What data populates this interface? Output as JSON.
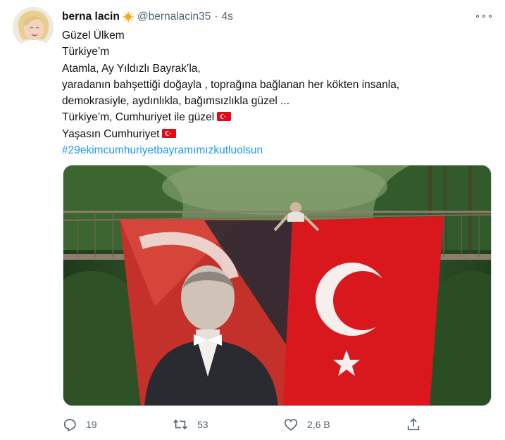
{
  "tweet": {
    "author_name": "berna lacin",
    "badge_icon": "sun-emoji",
    "handle": "@bernalacin35",
    "separator": "·",
    "time": "4s",
    "menu_icon": "more-icon",
    "lines": [
      "Güzel Ülkem",
      "Türkiye’m",
      "Atamla, Ay Yıldızlı Bayrak’la,",
      "yaradanın bahşettiği doğayla , toprağına bağlanan her kökten insanla,",
      "demokrasiyle, aydınlıkla, bağımsızlıkla güzel ...",
      "Türkiye’m, Cumhuriyet ile güzel",
      "Yaşasın Cumhuriyet"
    ],
    "flag_emoji": "turkish-flag-emoji",
    "hashtag": "#29ekimcumhuriyetbayramımızkutluolsun",
    "media": {
      "subject": "Two large flags hung from a suspension bridge over a forest: Atatürk portrait flag and Turkish flag"
    },
    "actions": {
      "reply_count": "19",
      "retweet_count": "53",
      "like_count": "2,6 B"
    },
    "colors": {
      "link": "#1d9bf0",
      "secondary_text": "#536471",
      "flag_red": "#e30a17"
    }
  }
}
